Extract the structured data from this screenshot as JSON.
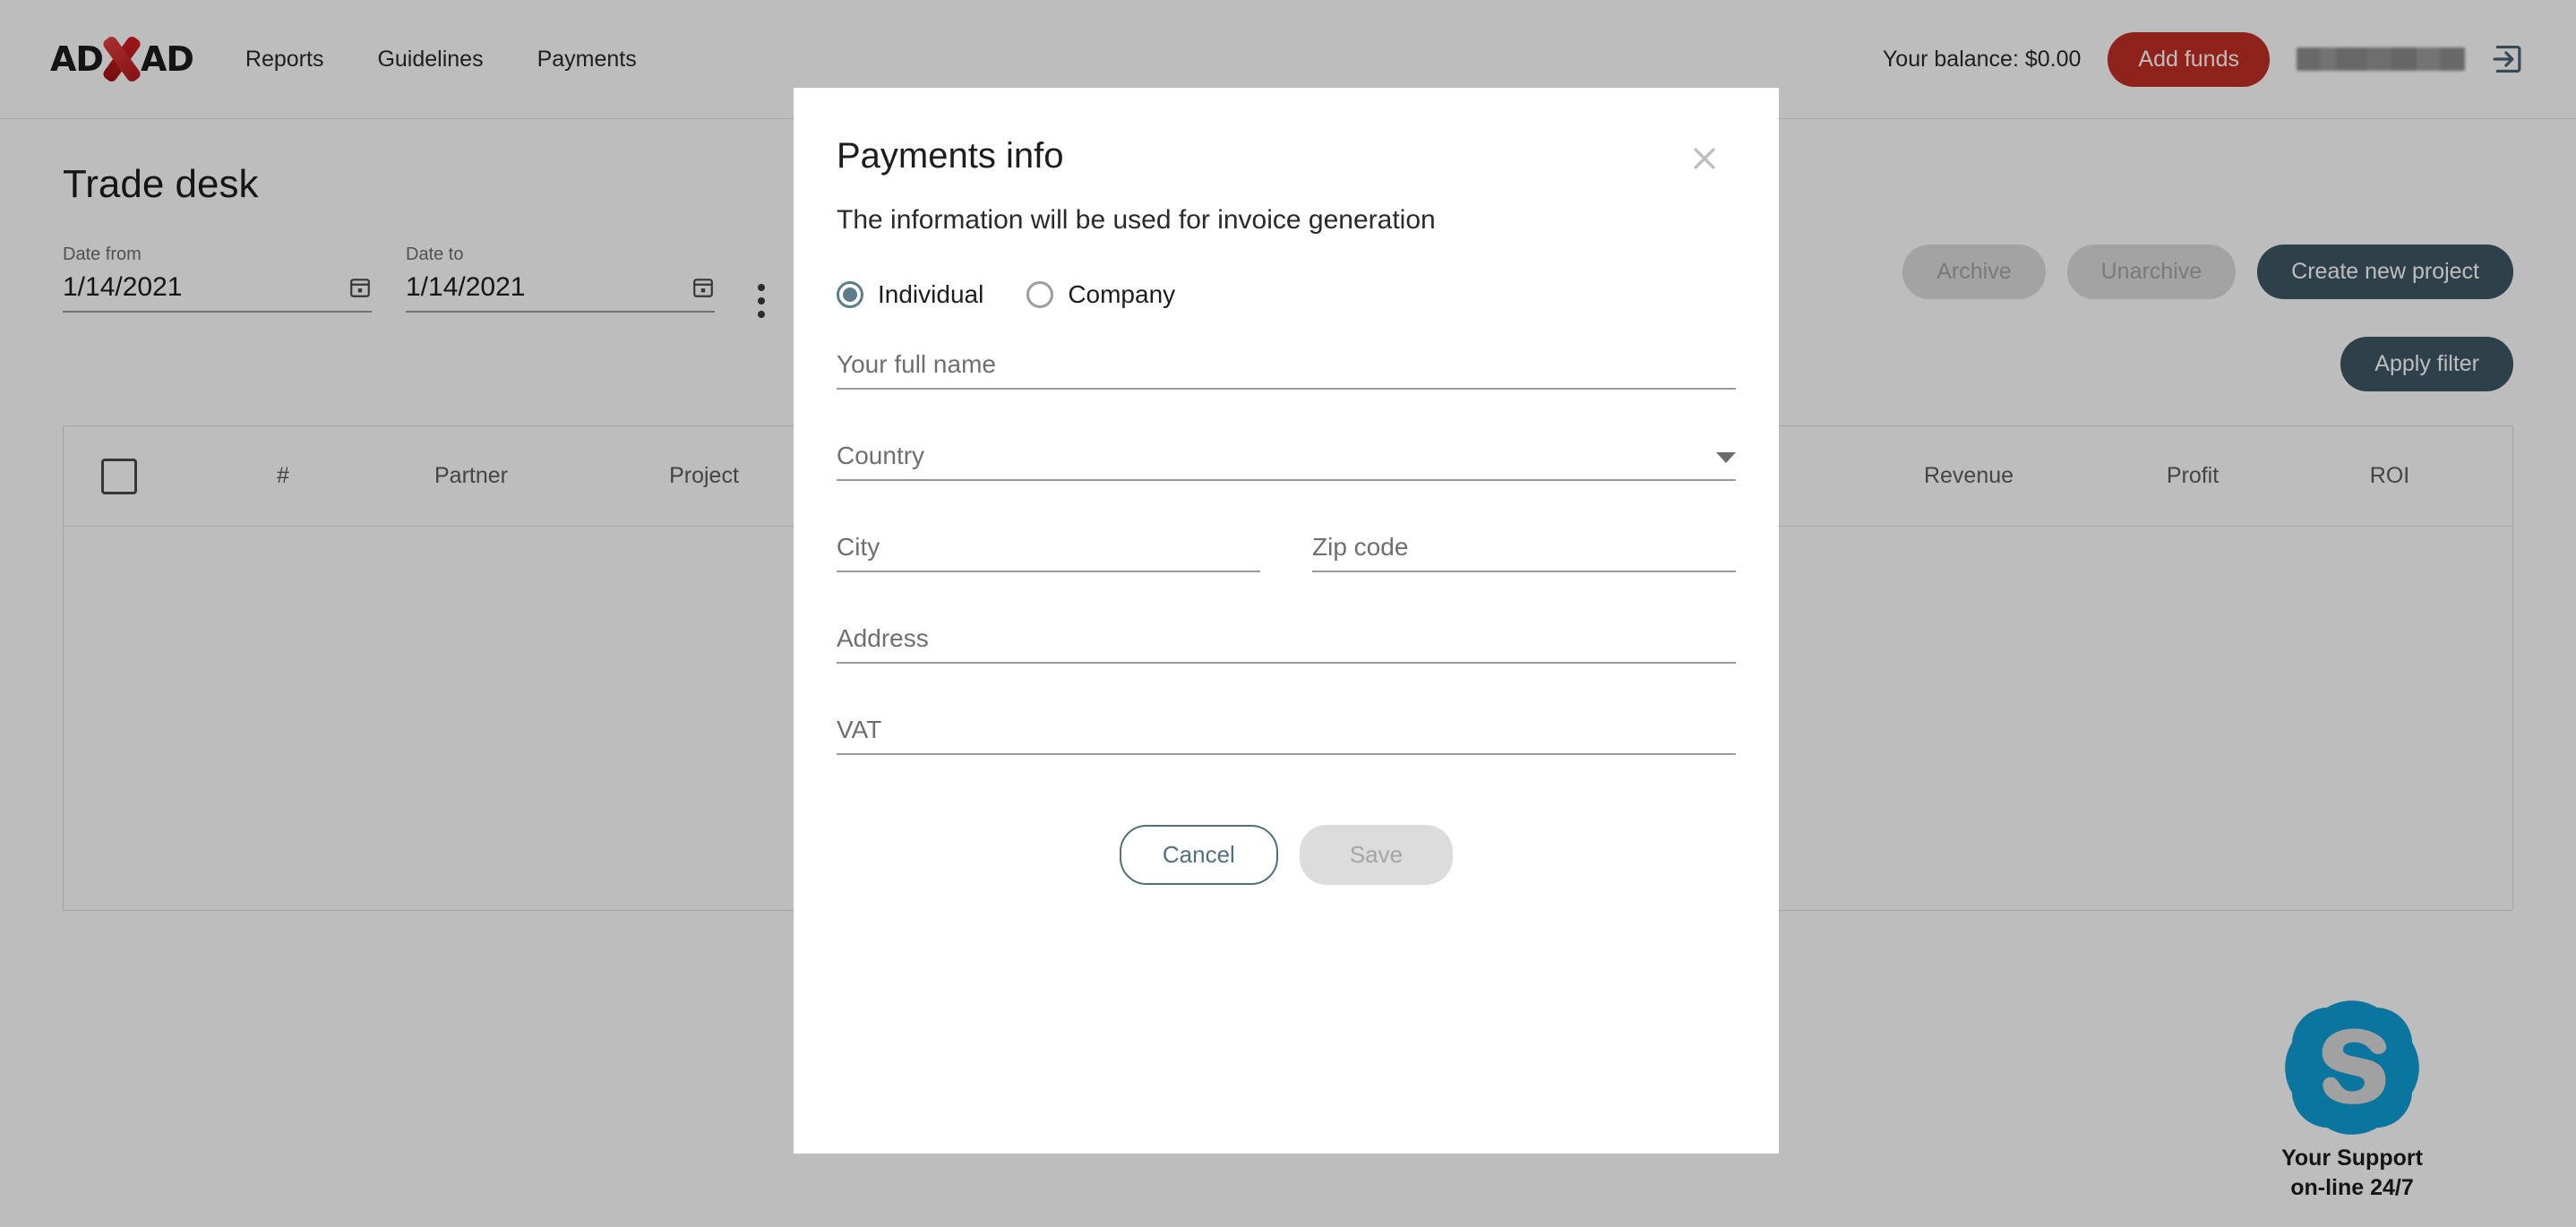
{
  "header": {
    "logo": {
      "left": "AD",
      "icon": "x-logo-icon",
      "right": "AD"
    },
    "nav": [
      {
        "label": "Reports"
      },
      {
        "label": "Guidelines"
      },
      {
        "label": "Payments"
      }
    ],
    "balance_text": "Your balance: $0.00",
    "add_funds_label": "Add funds",
    "username_masked": "",
    "logout_icon": "logout-icon"
  },
  "main": {
    "page_title": "Trade desk",
    "filters": {
      "date_from": {
        "label": "Date from",
        "value": "1/14/2021",
        "icon": "calendar-icon"
      },
      "date_to": {
        "label": "Date to",
        "value": "1/14/2021",
        "icon": "calendar-icon"
      },
      "apply_filter_label": "Apply filter",
      "more_menu_icon": "kebab-menu-icon"
    },
    "actions": {
      "archive_label": "Archive",
      "unarchive_label": "Unarchive",
      "create_project_label": "Create new project"
    },
    "table": {
      "columns": [
        "#",
        "Partner",
        "Project",
        "Revenue",
        "Profit",
        "ROI"
      ],
      "select_all_icon": "checkbox-icon",
      "rows": []
    },
    "support": {
      "icon": "skype-icon",
      "line1": "Your Support",
      "line2": "on-line 24/7"
    }
  },
  "modal": {
    "title": "Payments info",
    "close_icon": "close-icon",
    "subtitle": "The information will be used for invoice generation",
    "entity_type": {
      "selected": "Individual",
      "options": [
        {
          "label": "Individual",
          "checked": true
        },
        {
          "label": "Company",
          "checked": false
        }
      ]
    },
    "fields": {
      "full_name": {
        "placeholder": "Your full name",
        "value": ""
      },
      "country": {
        "placeholder": "Country",
        "value": "",
        "icon": "chevron-down-icon"
      },
      "city": {
        "placeholder": "City",
        "value": ""
      },
      "zip": {
        "placeholder": "Zip code",
        "value": ""
      },
      "address": {
        "placeholder": "Address",
        "value": ""
      },
      "vat": {
        "placeholder": "VAT",
        "value": ""
      }
    },
    "cancel_label": "Cancel",
    "save_label": "Save"
  },
  "colors": {
    "brand_red": "#c32f26",
    "primary_slate": "#3e5763",
    "radio_accent": "#5d7d8c",
    "skype_blue": "#0e9ed5",
    "disabled_bg": "#dcdcdc",
    "disabled_text": "#a5a5a5"
  }
}
